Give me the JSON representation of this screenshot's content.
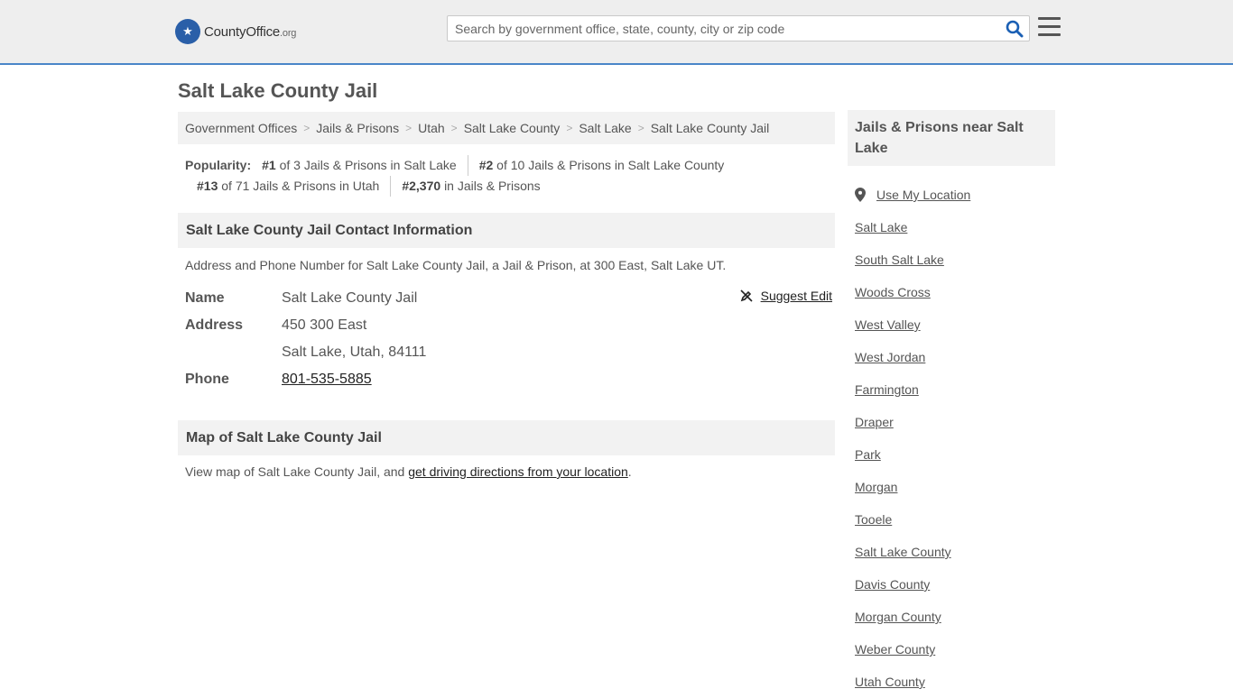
{
  "header": {
    "logo_text_main": "County",
    "logo_text_bold": "Office",
    "logo_text_suffix": ".org",
    "search_placeholder": "Search by government office, state, county, city or zip code"
  },
  "page_title": "Salt Lake County Jail",
  "breadcrumb": [
    "Government Offices",
    "Jails & Prisons",
    "Utah",
    "Salt Lake County",
    "Salt Lake",
    "Salt Lake County Jail"
  ],
  "popularity": {
    "label": "Popularity:",
    "items": [
      {
        "rank": "#1",
        "text": "of 3 Jails & Prisons in Salt Lake"
      },
      {
        "rank": "#2",
        "text": "of 10 Jails & Prisons in Salt Lake County"
      },
      {
        "rank": "#13",
        "text": "of 71 Jails & Prisons in Utah"
      },
      {
        "rank": "#2,370",
        "text": "in Jails & Prisons"
      }
    ]
  },
  "contact": {
    "heading": "Salt Lake County Jail Contact Information",
    "description": "Address and Phone Number for Salt Lake County Jail, a Jail & Prison, at 300 East, Salt Lake UT.",
    "suggest_edit": "Suggest Edit",
    "name_label": "Name",
    "name_value": "Salt Lake County Jail",
    "address_label": "Address",
    "address_line1": "450 300 East",
    "address_line2": "Salt Lake, Utah, 84111",
    "phone_label": "Phone",
    "phone_value": "801-535-5885"
  },
  "map": {
    "heading": "Map of Salt Lake County Jail",
    "desc_prefix": "View map of Salt Lake County Jail, and ",
    "desc_link": "get driving directions from your location",
    "desc_suffix": "."
  },
  "sidebar": {
    "heading": "Jails & Prisons near Salt Lake",
    "use_location": "Use My Location",
    "items": [
      "Salt Lake",
      "South Salt Lake",
      "Woods Cross",
      "West Valley",
      "West Jordan",
      "Farmington",
      "Draper",
      "Park",
      "Morgan",
      "Tooele",
      "Salt Lake County",
      "Davis County",
      "Morgan County",
      "Weber County",
      "Utah County"
    ]
  },
  "colors": {
    "accent_border": "#4a86c8",
    "logo_blue": "#2a5fa8",
    "search_icon": "#1a5fb4"
  }
}
